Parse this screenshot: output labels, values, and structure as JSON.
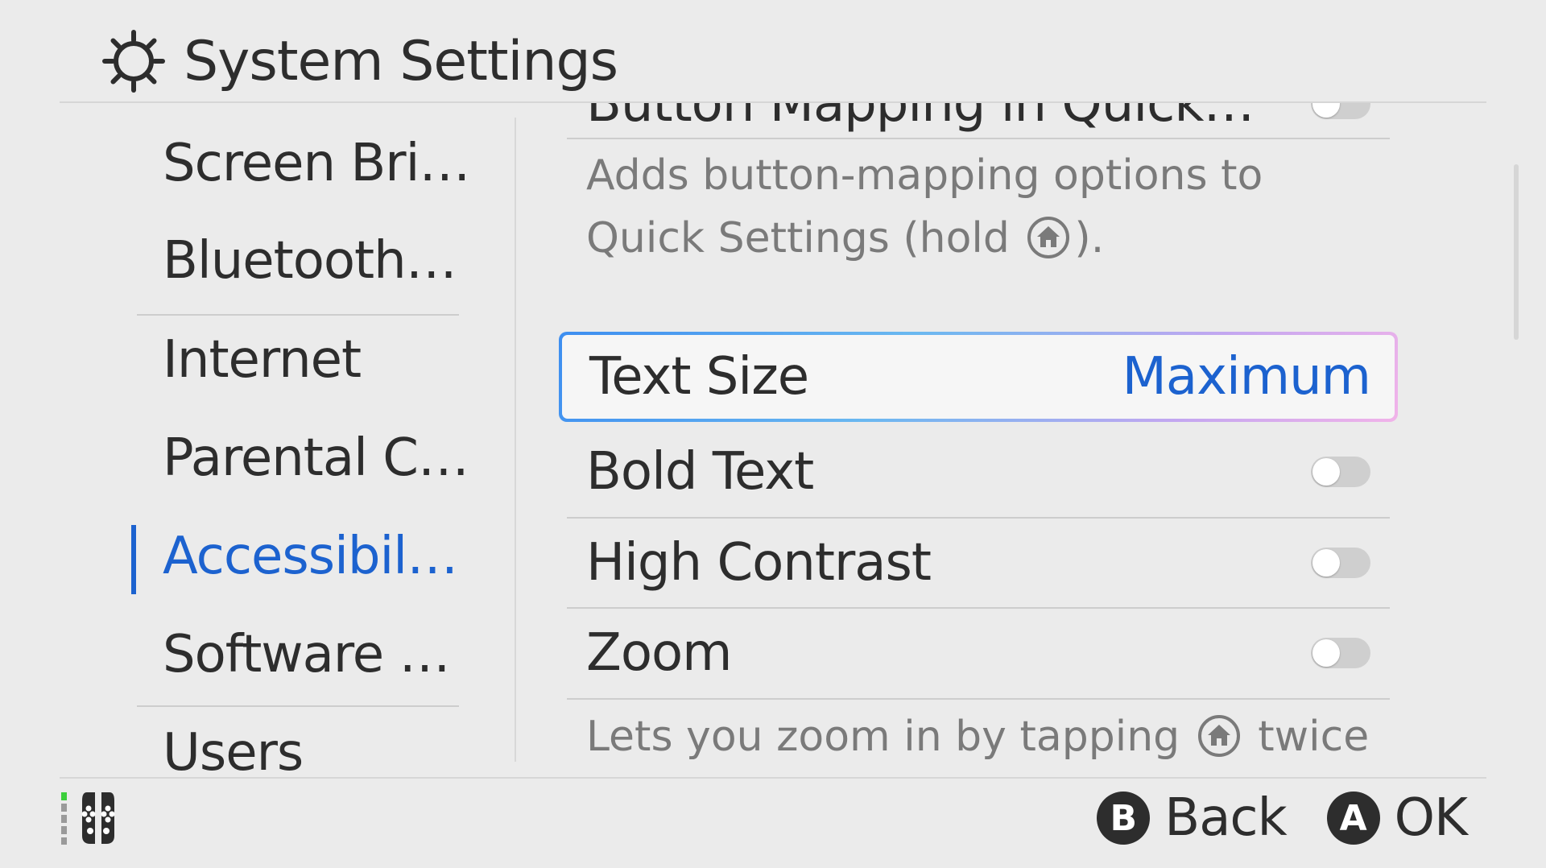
{
  "header": {
    "title": "System Settings",
    "icon": "gear-icon"
  },
  "sidebar": {
    "items": [
      {
        "label": "Screen Bri…"
      },
      {
        "label": "Bluetooth…"
      },
      {
        "label": "Internet"
      },
      {
        "label": "Parental C…"
      },
      {
        "label": "Accessibil…",
        "selected": true
      },
      {
        "label": "Software …"
      },
      {
        "label": "Users"
      }
    ]
  },
  "content": {
    "cut_row_label": "Button Mapping in Quick…",
    "button_mapping_desc_line1": "Adds button-mapping options to",
    "button_mapping_desc_line2_prefix": "Quick Settings (hold ",
    "button_mapping_desc_line2_suffix": ").",
    "text_size": {
      "label": "Text Size",
      "value": "Maximum"
    },
    "bold_text": {
      "label": "Bold Text",
      "on": false
    },
    "high_contrast": {
      "label": "High Contrast",
      "on": false
    },
    "zoom": {
      "label": "Zoom",
      "on": false
    },
    "zoom_desc_prefix": "Lets you zoom in by tapping ",
    "zoom_desc_suffix": " twice"
  },
  "footer": {
    "back": {
      "key": "B",
      "label": "Back"
    },
    "ok": {
      "key": "A",
      "label": "OK"
    }
  },
  "colors": {
    "accent": "#1c62cf",
    "background": "#ebebeb",
    "text": "#2d2d2d"
  }
}
